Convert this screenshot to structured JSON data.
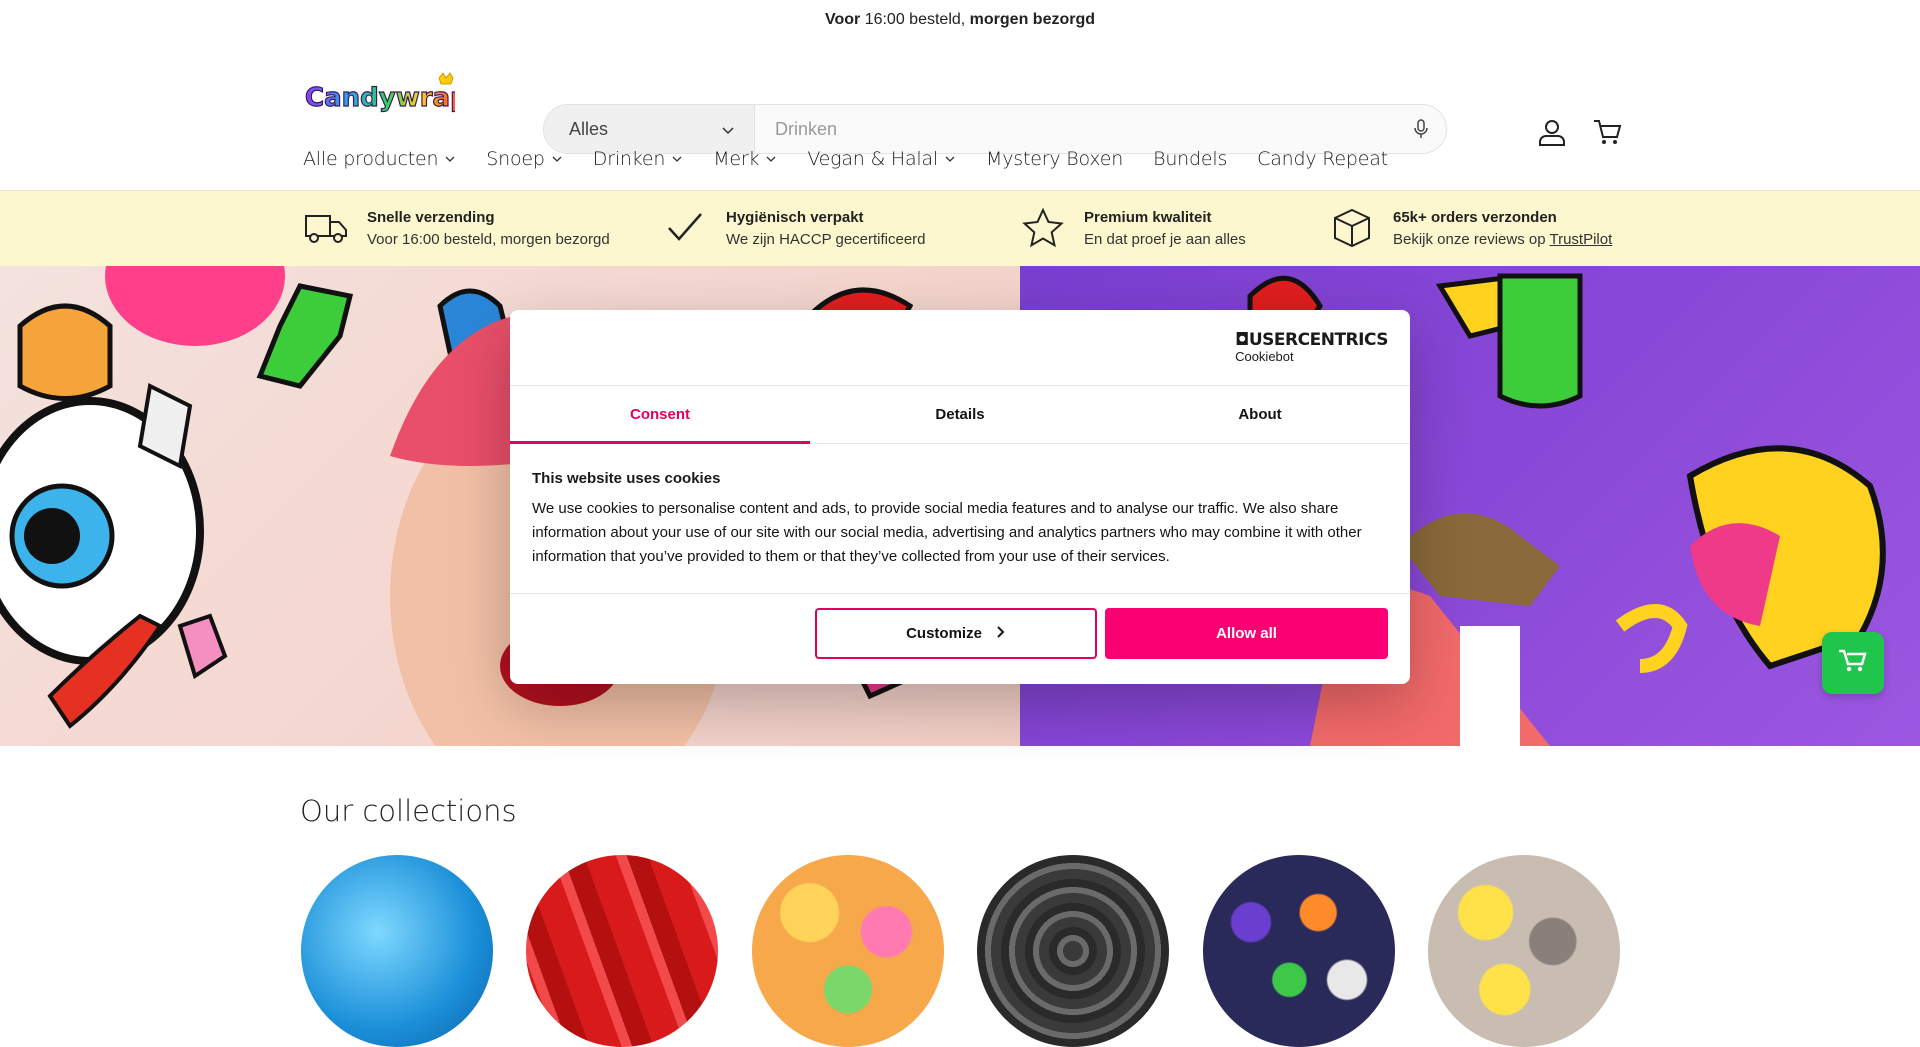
{
  "announcement": {
    "prefix": "Voor",
    "time": "16:00 besteld,",
    "suffix": "morgen bezorgd"
  },
  "header": {
    "logo_text": "Candywrap",
    "search": {
      "category": "Alles",
      "placeholder": "Drinken"
    }
  },
  "nav": {
    "items": [
      {
        "label": "Alle producten",
        "dropdown": true
      },
      {
        "label": "Snoep",
        "dropdown": true
      },
      {
        "label": "Drinken",
        "dropdown": true
      },
      {
        "label": "Merk",
        "dropdown": true
      },
      {
        "label": "Vegan & Halal",
        "dropdown": true
      },
      {
        "label": "Mystery Boxen",
        "dropdown": false
      },
      {
        "label": "Bundels",
        "dropdown": false
      },
      {
        "label": "Candy Repeat",
        "dropdown": false
      }
    ]
  },
  "usp": [
    {
      "icon": "truck-icon",
      "title": "Snelle verzending",
      "text": "Voor 16:00 besteld, morgen bezorgd"
    },
    {
      "icon": "checkmark-icon",
      "title": "Hygiënisch verpakt",
      "text": "We zijn HACCP gecertificeerd"
    },
    {
      "icon": "star-icon",
      "title": "Premium kwaliteit",
      "text": "En dat proef je aan alles"
    },
    {
      "icon": "box-icon",
      "title": "65k+ orders verzonden",
      "text": "Bekijk onze reviews op",
      "link": "TrustPilot"
    }
  ],
  "cookie_dialog": {
    "brand_line1": "USERCENTRICS",
    "brand_line2": "Cookiebot",
    "tabs": [
      "Consent",
      "Details",
      "About"
    ],
    "active_tab": "Consent",
    "title": "This website uses cookies",
    "body": "We use cookies to personalise content and ads, to provide social media features and to analyse our traffic. We also share information about your use of our site with our social media, advertising and analytics partners who may combine it with other information that you’ve provided to them or that they’ve collected from your use of their services.",
    "customize_label": "Customize",
    "allow_label": "Allow all"
  },
  "collections": {
    "title": "Our collections"
  },
  "colors": {
    "accent": "#fb0073",
    "active_tab": "#e2005f",
    "usp_bg": "#fdf7cf",
    "chat": "#1fc64b"
  }
}
